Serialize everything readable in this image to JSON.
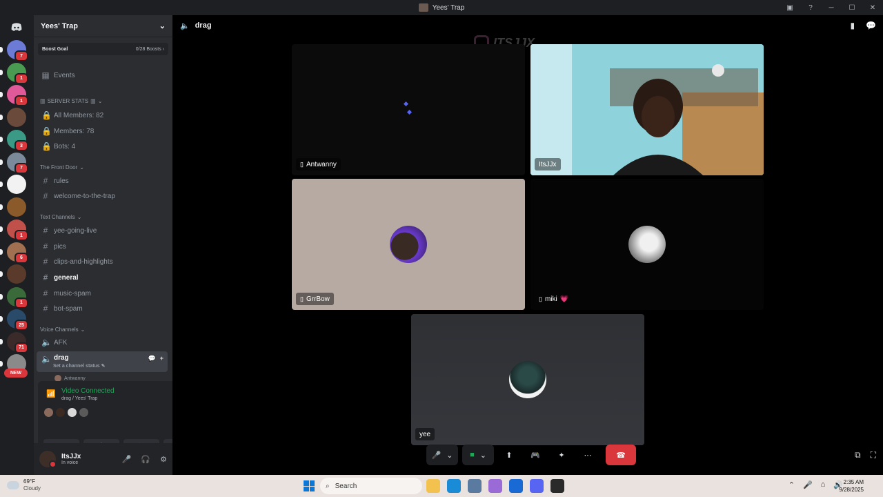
{
  "window": {
    "title": "Yees' Trap",
    "controls": {
      "minimize": "─",
      "maximize": "☐",
      "close": "✕"
    }
  },
  "rail": {
    "logo_icon": "discord-logo",
    "servers": [
      {
        "badge": "7",
        "color": "#6c7bd6"
      },
      {
        "badge": "1",
        "color": "#4a9a52"
      },
      {
        "badge": "1",
        "color": "#e05a9a"
      },
      {
        "badge": "",
        "color": "#6a4a3a"
      },
      {
        "badge": "3",
        "color": "#3a9a86"
      },
      {
        "badge": "7",
        "color": "#7a8a9a"
      },
      {
        "badge": "",
        "color": "#f2f2f2"
      },
      {
        "badge": "",
        "color": "#8a5a2a"
      },
      {
        "badge": "1",
        "color": "#c0504a"
      },
      {
        "badge": "6",
        "color": "#a07050"
      },
      {
        "badge": "",
        "color": "#5a3a2a"
      },
      {
        "badge": "1",
        "color": "#3a6a3a"
      },
      {
        "badge": "25",
        "color": "#2a4a6a"
      },
      {
        "badge": "71",
        "color": "#3a2a2a"
      },
      {
        "badge": "",
        "color": "#8a8a8a"
      }
    ],
    "new_label": "NEW"
  },
  "sidebar": {
    "server_name": "Yees' Trap",
    "boost_goal": {
      "label": "Boost Goal",
      "value": "0/28 Boosts"
    },
    "events_label": "Events",
    "server_stats_category": "SERVER STATS",
    "stats": [
      "All Members: 82",
      "Members: 78",
      "Bots: 4"
    ],
    "front_door_category": "The Front Door",
    "front_door_channels": [
      "rules",
      "welcome-to-the-trap"
    ],
    "text_category": "Text Channels",
    "text_channels": [
      "yee-going-live",
      "pics",
      "clips-and-highlights",
      "general",
      "music-spam",
      "bot-spam"
    ],
    "voice_category": "Voice Channels",
    "voice_channels": [
      "AFK",
      "drag"
    ],
    "drag_status_hint": "Set a channel status",
    "voice_user_preview": "Antwanny",
    "voice_panel": {
      "status": "Video Connected",
      "location": "drag / Yees' Trap",
      "avatars": [
        "#8a6a5c",
        "#3a2a22",
        "#d9d9d9",
        "#5a5a5a"
      ]
    },
    "user": {
      "name": "ItsJJx",
      "status": "In voice"
    }
  },
  "main": {
    "channel_name": "drag",
    "watermark": "ITSJJX",
    "tiles": [
      {
        "name": "Antwanny",
        "mobile": true
      },
      {
        "name": "ItsJJx",
        "mobile": false
      },
      {
        "name": "GrrBow",
        "mobile": true
      },
      {
        "name": "miki",
        "mobile": true,
        "suffix": "💗"
      },
      {
        "name": "yee",
        "mobile": false
      }
    ]
  },
  "taskbar": {
    "weather_temp": "69°F",
    "weather_cond": "Cloudy",
    "search_placeholder": "Search",
    "time": "2:35 AM",
    "date": "9/28/2025",
    "apps": [
      {
        "name": "file-explorer",
        "color": "#f2c14e"
      },
      {
        "name": "edge",
        "color": "#1a8bd6"
      },
      {
        "name": "settings",
        "color": "#5a7aa0"
      },
      {
        "name": "copilot",
        "color": "#9a6ad6"
      },
      {
        "name": "store",
        "color": "#1a6ad6"
      },
      {
        "name": "discord",
        "color": "#5865f2"
      },
      {
        "name": "obs",
        "color": "#2a2a2a"
      }
    ]
  }
}
